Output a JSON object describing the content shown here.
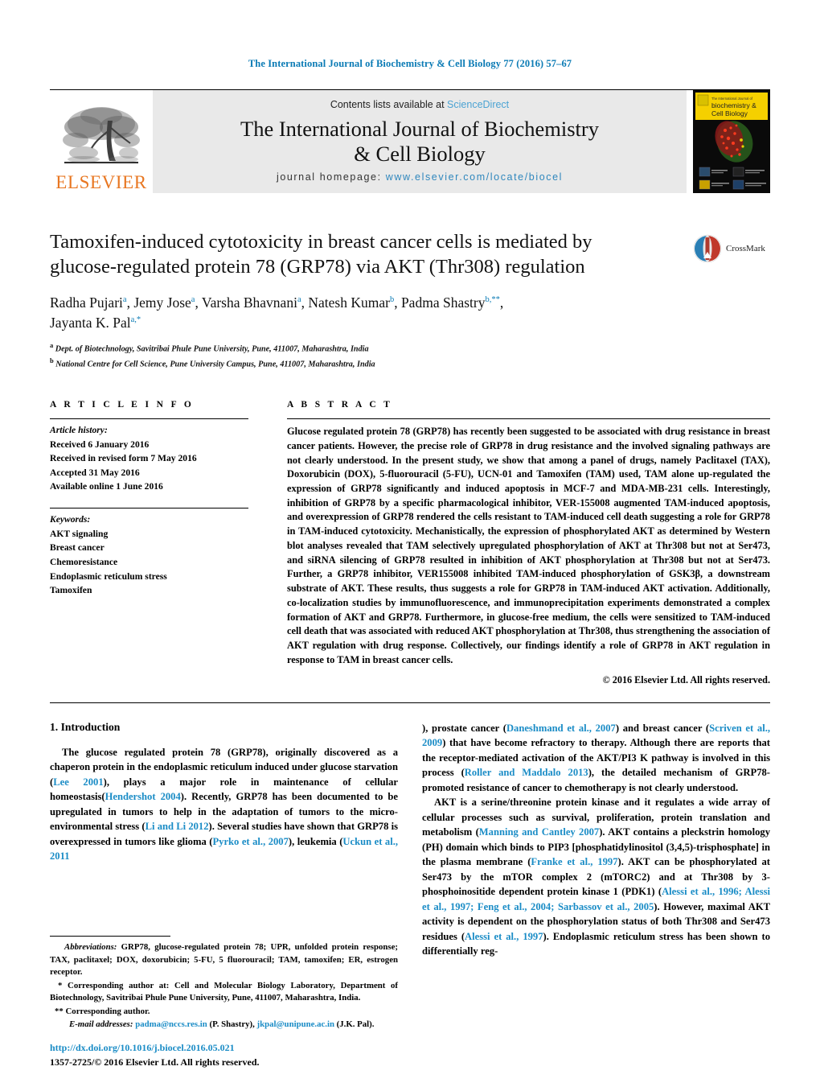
{
  "running_head": "The International Journal of Biochemistry & Cell Biology 77 (2016) 57–67",
  "masthead": {
    "publisher_logo_word": "ELSEVIER",
    "contents_prefix": "Contents lists available at ",
    "contents_link": "ScienceDirect",
    "journal_title_line1": "The International Journal of Biochemistry",
    "journal_title_line2": "& Cell Biology",
    "homepage_prefix": "journal homepage: ",
    "homepage_url": "www.elsevier.com/locate/biocel",
    "cover_title_line1": "The International Journal of",
    "cover_title_line2": "biochemistry &",
    "cover_title_line3": "Cell Biology"
  },
  "article": {
    "title_line1": "Tamoxifen-induced cytotoxicity in breast cancer cells is mediated by",
    "title_line2": "glucose-regulated protein 78 (GRP78) via AKT (Thr308) regulation",
    "crossmark_label": "CrossMark",
    "authors": [
      {
        "name": "Radha Pujari",
        "sup": "a"
      },
      {
        "name": "Jemy Jose",
        "sup": "a"
      },
      {
        "name": "Varsha Bhavnani",
        "sup": "a"
      },
      {
        "name": "Natesh Kumar",
        "sup": "b"
      },
      {
        "name": "Padma Shastry",
        "sup": "b,**"
      },
      {
        "name": "Jayanta K. Pal",
        "sup": "a,*"
      }
    ],
    "affiliations": [
      {
        "marker": "a",
        "text": "Dept. of Biotechnology, Savitribai Phule Pune University, Pune, 411007, Maharashtra, India"
      },
      {
        "marker": "b",
        "text": "National Centre for Cell Science, Pune University Campus, Pune, 411007, Maharashtra, India"
      }
    ]
  },
  "article_info": {
    "heading": "A R T I C L E    I N F O",
    "history_label": "Article history:",
    "history": [
      "Received 6 January 2016",
      "Received in revised form 7 May 2016",
      "Accepted 31 May 2016",
      "Available online 1 June 2016"
    ],
    "keywords_label": "Keywords:",
    "keywords": [
      "AKT signaling",
      "Breast cancer",
      "Chemoresistance",
      "Endoplasmic reticulum stress",
      "Tamoxifen"
    ]
  },
  "abstract": {
    "heading": "A B S T R A C T",
    "text": "Glucose regulated protein 78 (GRP78) has recently been suggested to be associated with drug resistance in breast cancer patients. However, the precise role of GRP78 in drug resistance and the involved signaling pathways are not clearly understood. In the present study, we show that among a panel of drugs, namely Paclitaxel (TAX), Doxorubicin (DOX), 5-fluorouracil (5-FU), UCN-01 and Tamoxifen (TAM) used, TAM alone up-regulated the expression of GRP78 significantly and induced apoptosis in MCF-7 and MDA-MB-231 cells. Interestingly, inhibition of GRP78 by a specific pharmacological inhibitor, VER-155008 augmented TAM-induced apoptosis, and overexpression of GRP78 rendered the cells resistant to TAM-induced cell death suggesting a role for GRP78 in TAM-induced cytotoxicity. Mechanistically, the expression of phosphorylated AKT as determined by Western blot analyses revealed that TAM selectively upregulated phosphorylation of AKT at Thr308 but not at Ser473, and siRNA silencing of GRP78 resulted in inhibition of AKT phosphorylation at Thr308 but not at Ser473. Further, a GRP78 inhibitor, VER155008 inhibited TAM-induced phosphorylation of GSK3β, a downstream substrate of AKT. These results, thus suggests a role for GRP78 in TAM-induced AKT activation. Additionally, co-localization studies by immunofluorescence, and immunoprecipitation experiments demonstrated a complex formation of AKT and GRP78. Furthermore, in glucose-free medium, the cells were sensitized to TAM-induced cell death that was associated with reduced AKT phosphorylation at Thr308, thus strengthening the association of AKT regulation with drug response. Collectively, our findings identify a role of GRP78 in AKT regulation in response to TAM in breast cancer cells.",
    "copyright": "© 2016 Elsevier Ltd. All rights reserved."
  },
  "body": {
    "section_title": "1. Introduction",
    "left_para_1_a": "The glucose regulated protein 78 (GRP78), originally discovered as a chaperon protein in the endoplasmic reticulum induced under glucose starvation (",
    "left_cite_1": "Lee 2001",
    "left_para_1_b": "), plays a major role in maintenance of cellular homeostasis(",
    "left_cite_2": "Hendershot 2004",
    "left_para_1_c": "). Recently, GRP78 has been documented to be upregulated in tumors to help in the adaptation of tumors to the micro-environmental stress (",
    "left_cite_3": "Li and Li 2012",
    "left_para_1_d": "). Several studies have shown that GRP78 is overexpressed in tumors like glioma (",
    "left_cite_4": "Pyrko et al., 2007",
    "left_para_1_e": "), leukemia (",
    "left_cite_5": "Uckun et al., 2011",
    "right_para_1_a": "), prostate cancer (",
    "right_cite_1": "Daneshmand et al., 2007",
    "right_para_1_b": ") and breast cancer (",
    "right_cite_2": "Scriven et al., 2009",
    "right_para_1_c": ") that have become refractory to therapy. Although there are reports that the receptor-mediated activation of the AKT/PI3 K pathway is involved in this process (",
    "right_cite_3": "Roller and Maddalo 2013",
    "right_para_1_d": "), the detailed mechanism of GRP78-promoted resistance of cancer to chemotherapy is not clearly understood.",
    "right_para_2_a": "AKT is a serine/threonine protein kinase and it regulates a wide array of cellular processes such as survival, proliferation, protein translation and metabolism (",
    "right_cite_4": "Manning and Cantley 2007",
    "right_para_2_b": "). AKT contains a pleckstrin homology (PH) domain which binds to PIP3 [phosphatidylinositol (3,4,5)-trisphosphate] in the plasma membrane (",
    "right_cite_5": "Franke et al., 1997",
    "right_para_2_c": "). AKT can be phosphorylated at Ser473 by the mTOR complex 2 (mTORC2) and at Thr308 by 3-phosphoinositide dependent protein kinase 1 (PDK1) (",
    "right_cite_6": "Alessi et al., 1996; Alessi et al., 1997; Feng et al., 2004; Sarbassov et al., 2005",
    "right_para_2_d": "). However, maximal AKT activity is dependent on the phosphorylation status of both Thr308 and Ser473 residues (",
    "right_cite_7": "Alessi et al., 1997",
    "right_para_2_e": "). Endoplasmic reticulum stress has been shown to differentially reg-"
  },
  "footnotes": {
    "abbrev_label": "Abbreviations:",
    "abbrev_text": " GRP78, glucose-regulated protein 78; UPR, unfolded protein response; TAX, paclitaxel; DOX, doxorubicin; 5-FU, 5 fluorouracil; TAM, tamoxifen; ER, estrogen receptor.",
    "corr1": "* Corresponding author at: Cell and Molecular Biology Laboratory, Department of Biotechnology, Savitribai Phule Pune University, Pune, 411007, Maharashtra, India.",
    "corr2": "** Corresponding author.",
    "email_label": "E-mail addresses:",
    "email1": "padma@nccs.res.in",
    "email1_owner": " (P. Shastry), ",
    "email2": "jkpal@unipune.ac.in",
    "email2_owner": " (J.K. Pal)."
  },
  "doi": {
    "url": "http://dx.doi.org/10.1016/j.biocel.2016.05.021",
    "issn_line": "1357-2725/© 2016 Elsevier Ltd. All rights reserved."
  },
  "colors": {
    "link": "#1a8cc6",
    "running_head": "#0b7bb5",
    "elsevier_orange": "#E87722",
    "masthead_bg": "#e9e9e9",
    "cover_yellow": "#f5d000"
  }
}
